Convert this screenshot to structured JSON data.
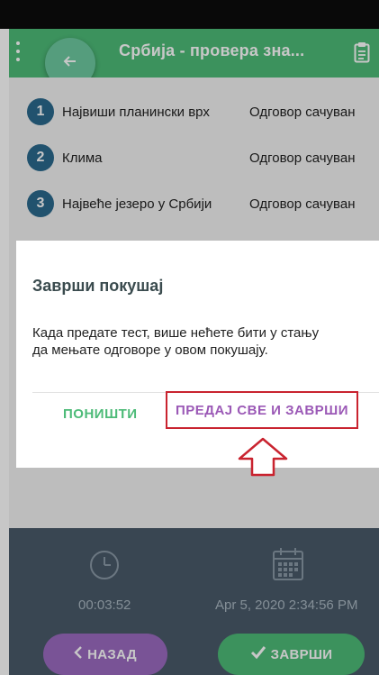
{
  "appbar": {
    "title": "Србија - провера зна...",
    "icons": [
      "menu-dots-icon",
      "clipboard-icon",
      "arrow-left-icon"
    ]
  },
  "questions": [
    {
      "number": "1",
      "label": "Највиши планински врх",
      "status": "Одговор сачуван"
    },
    {
      "number": "2",
      "label": "Клима",
      "status": "Одговор сачуван"
    },
    {
      "number": "3",
      "label": "Највеће језеро у Србији",
      "status": "Одговор сачуван"
    }
  ],
  "dialog": {
    "title": "Заврши покушај",
    "body": "Када предате тест, више нећете бити у стању да мењате одговоре у овом покушају.",
    "cancel_label": "ПОНИШТИ",
    "submit_label": "ПРЕДАЈ СВЕ И ЗАВРШИ"
  },
  "footer": {
    "timer": "00:03:52",
    "date": "Apr 5, 2020 2:34:56 PM",
    "back_label": "НАЗАД",
    "finish_label": "ЗАВРШИ",
    "icons": [
      "clock-icon",
      "calendar-icon",
      "chevron-left-icon",
      "check-icon"
    ]
  },
  "colors": {
    "primary": "#4dbb78",
    "accent_purple": "#9b59b6",
    "question_badge": "#2b6a8e",
    "highlight_red": "#c9232f",
    "footer_bg": "#4a5a6a"
  }
}
